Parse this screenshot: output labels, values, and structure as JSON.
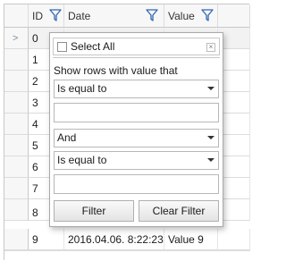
{
  "columns": [
    {
      "label": "ID"
    },
    {
      "label": "Date"
    },
    {
      "label": "Value"
    }
  ],
  "rows": [
    {
      "id": "0",
      "date": "",
      "value": ""
    },
    {
      "id": "1",
      "date": "",
      "value": ""
    },
    {
      "id": "2",
      "date": "",
      "value": ""
    },
    {
      "id": "3",
      "date": "",
      "value": ""
    },
    {
      "id": "4",
      "date": "",
      "value": ""
    },
    {
      "id": "5",
      "date": "",
      "value": ""
    },
    {
      "id": "6",
      "date": "",
      "value": ""
    },
    {
      "id": "7",
      "date": "",
      "value": ""
    },
    {
      "id": "8",
      "date": "",
      "value": ""
    },
    {
      "id": "9",
      "date": "2016.04.06. 8:22:23",
      "value": "Value 9"
    }
  ],
  "filter_popup": {
    "select_all_label": "Select All",
    "close_glyph": "×",
    "caption": "Show rows with value that",
    "operator1": "Is equal to",
    "value1": "",
    "logical_operator": "And",
    "operator2": "Is equal to",
    "value2": "",
    "filter_button": "Filter",
    "clear_button": "Clear Filter"
  },
  "icons": {
    "filter_icon": "funnel-icon",
    "current_row_indicator": "arrow-right-icon"
  },
  "colors": {
    "funnel_stroke": "#2f67b1",
    "border": "#c8c8c8",
    "header_bg": "#f7f7f7"
  }
}
